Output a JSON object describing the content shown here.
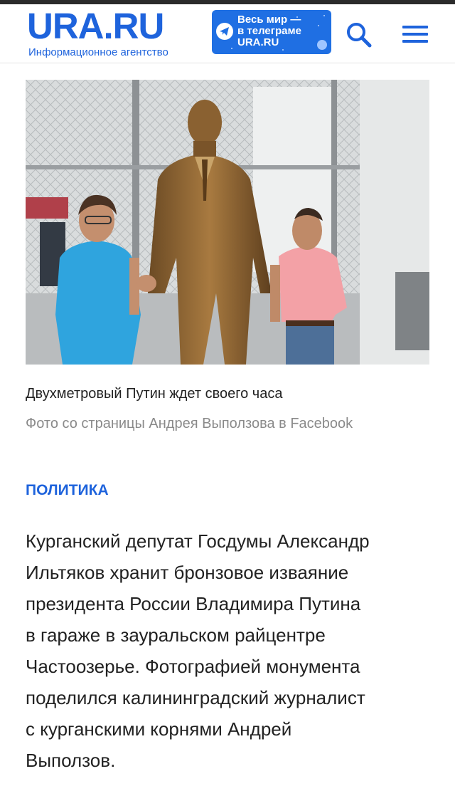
{
  "header": {
    "logo_word": "URA.RU",
    "logo_tagline": "Информационное агентство",
    "telegram_banner": {
      "lines": [
        "Весь мир —",
        "в телеграме",
        "URA.RU"
      ]
    },
    "search_icon": "search-icon",
    "menu_icon": "hamburger-menu-icon"
  },
  "article": {
    "photo_caption": "Двухметровый Путин ждет своего часа",
    "photo_credit": "Фото со страницы Андрея Выползова в Facebook",
    "category": "ПОЛИТИКА",
    "lead_lines": [
      "Курганский депутат Госдумы Александр",
      "Ильтяков хранит бронзовое изваяние",
      "президента России Владимира Путина",
      "в гараже в зауральском райцентре",
      "Частоозерье. Фотографией монумента",
      "поделился калининградский журналист",
      "с курганскими корнями Андрей",
      "Выползов."
    ]
  },
  "colors": {
    "brand_blue": "#1e63dc",
    "telegram_banner_bg": "#1f6fe3",
    "text": "#222222",
    "muted_text": "#8a8a8a"
  }
}
